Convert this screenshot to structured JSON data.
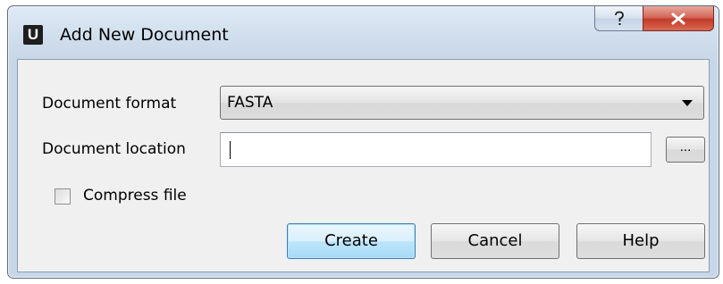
{
  "window": {
    "title": "Add New Document",
    "app_icon_letter": "U"
  },
  "titlebar_buttons": {
    "help": "?",
    "close": "x"
  },
  "form": {
    "format_label": "Document format",
    "format_value": "FASTA",
    "location_label": "Document location",
    "location_value": "",
    "browse_label": "...",
    "compress_label": "Compress file",
    "compress_checked": false
  },
  "buttons": {
    "create": "Create",
    "cancel": "Cancel",
    "help": "Help"
  }
}
